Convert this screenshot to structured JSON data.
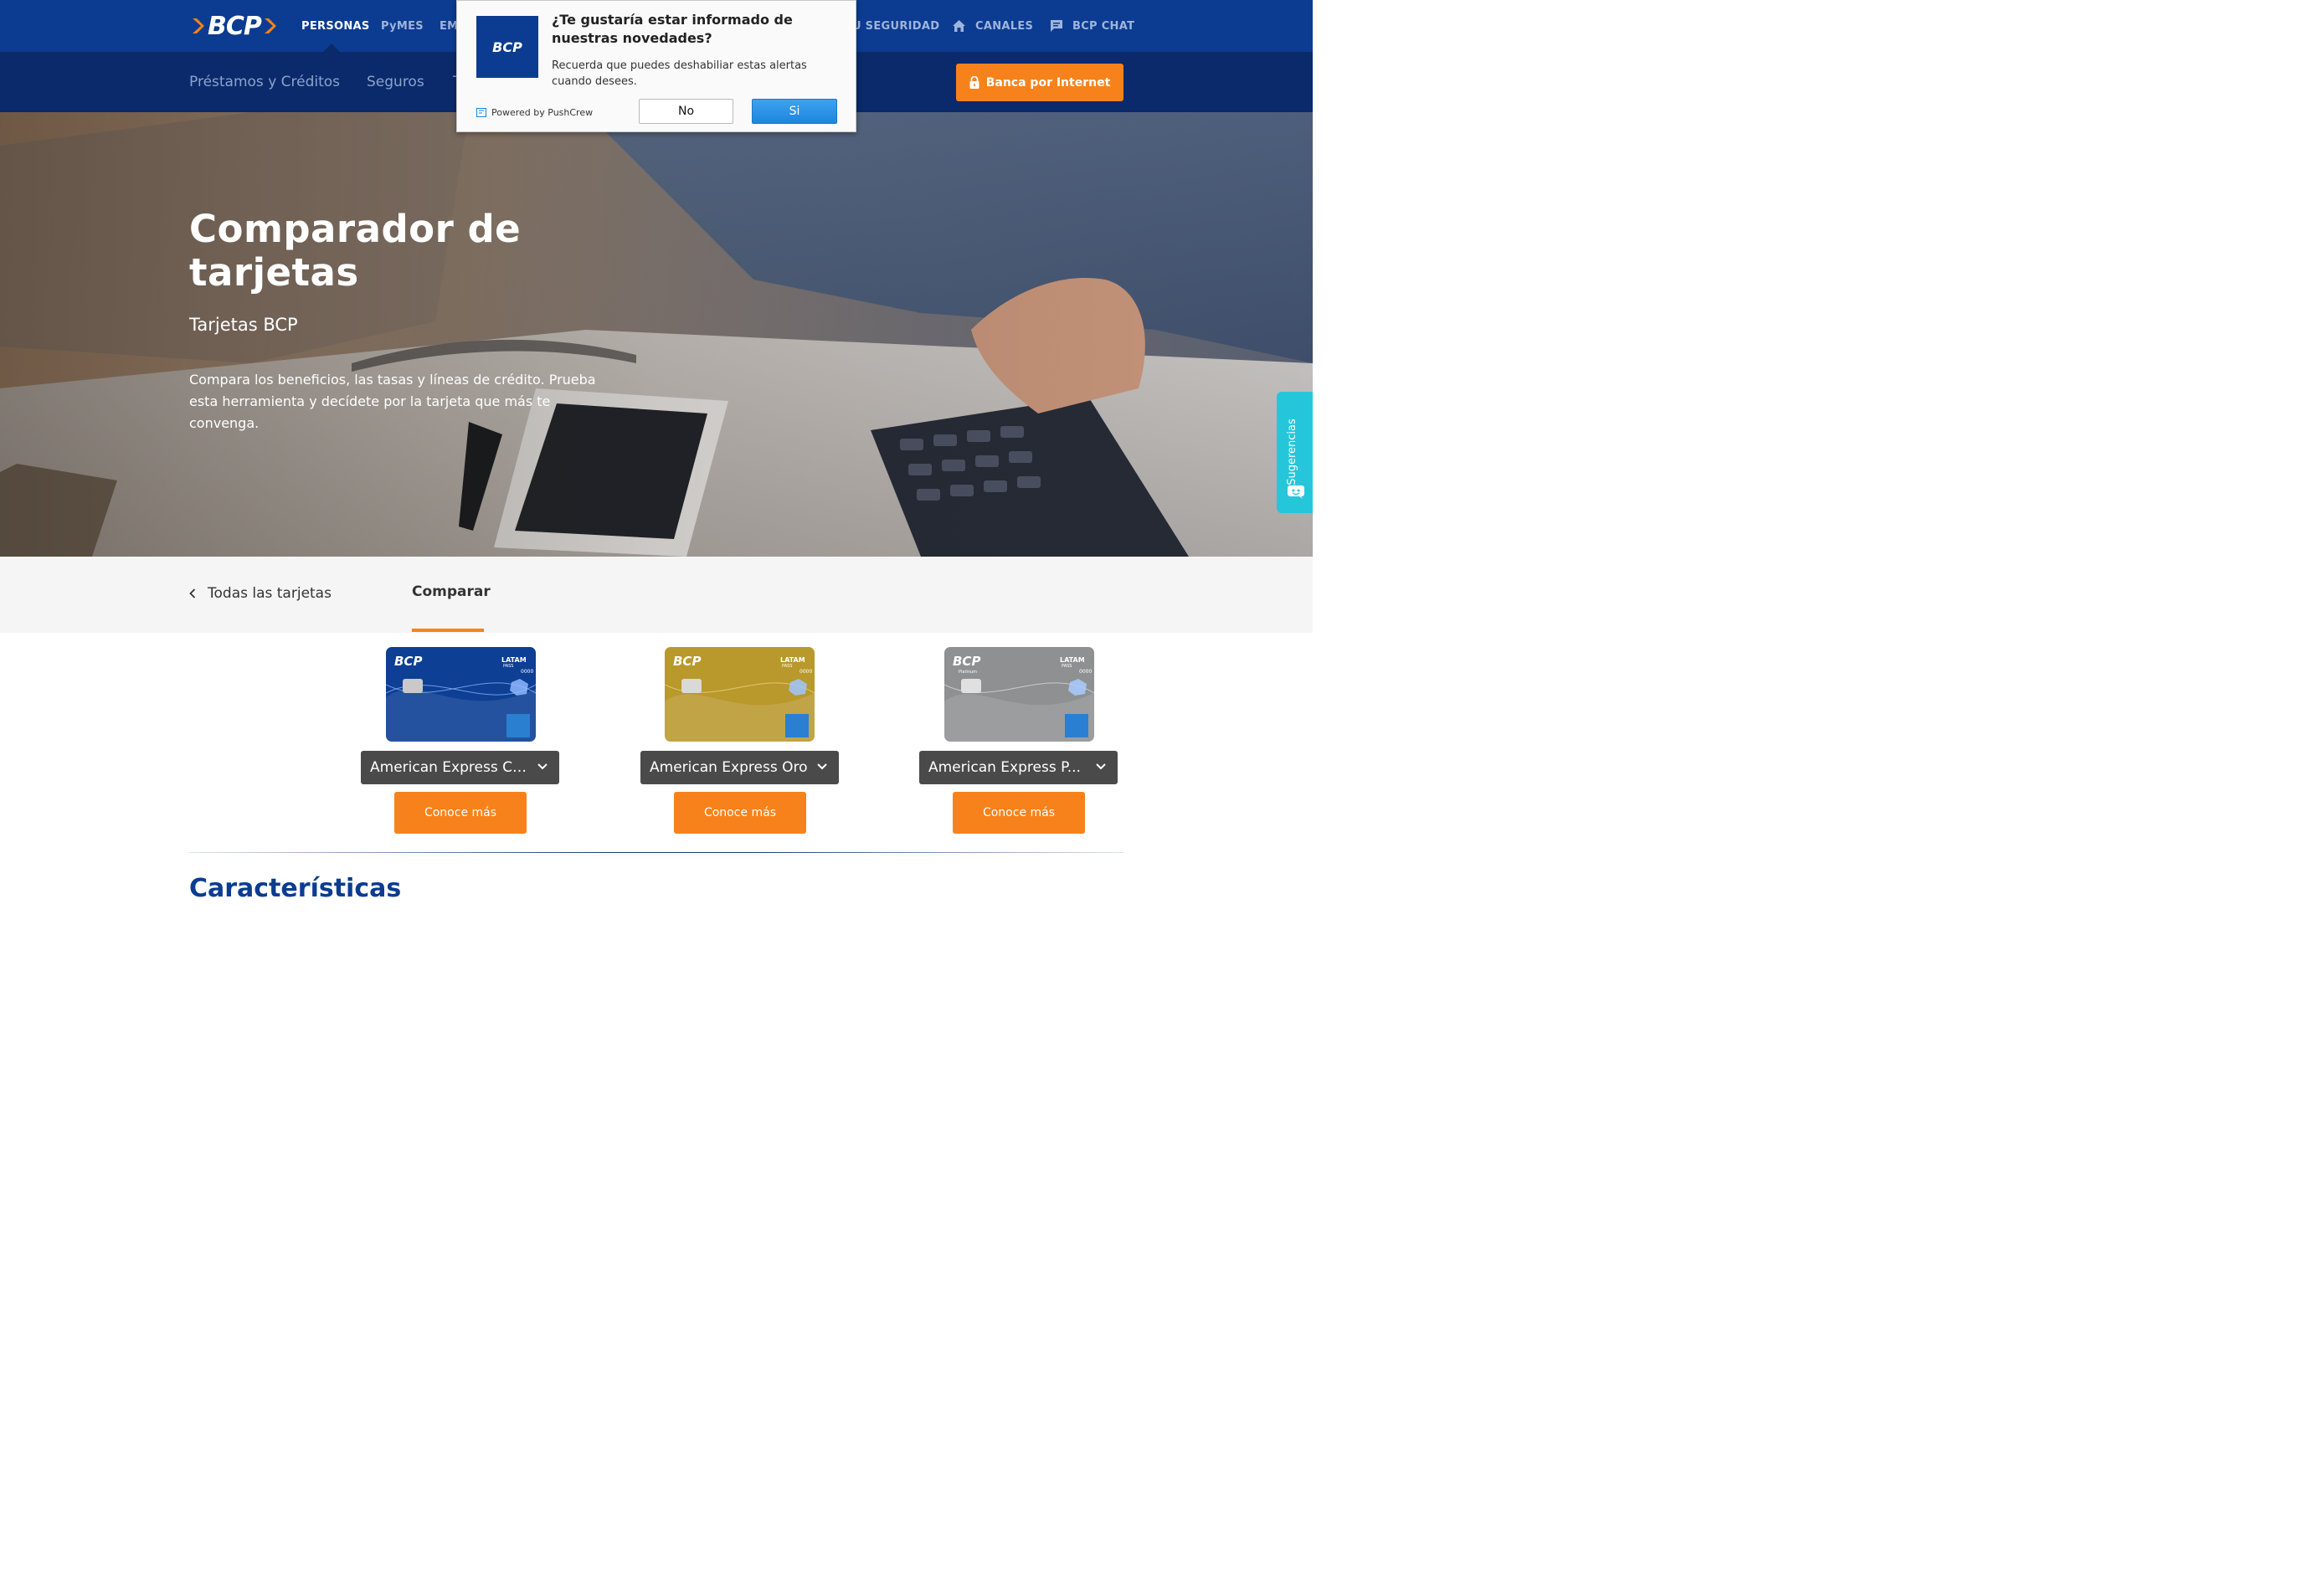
{
  "brand": {
    "logo_text": "BCP"
  },
  "topnav": {
    "items": [
      "PERSONAS",
      "PyMES",
      "EM"
    ],
    "right": {
      "seguridad": "U SEGURIDAD",
      "canales": "CANALES",
      "chat": "BCP CHAT"
    }
  },
  "subnav": {
    "items": [
      "Préstamos y Créditos",
      "Seguros",
      "T"
    ],
    "banca_button": "Banca por Internet"
  },
  "hero": {
    "title": "Comparador de tarjetas",
    "subtitle": "Tarjetas BCP",
    "description": "Compara los beneficios, las tasas y líneas de crédito. Prueba esta herramienta y decídete por la tarjeta que más te convenga."
  },
  "side_tab": {
    "label": "Sugerencias"
  },
  "tabs": {
    "back": "Todas las tarjetas",
    "compare": "Comparar"
  },
  "cards": [
    {
      "select_value": "American Express Cl...",
      "button": "Conoce más",
      "color": "#0d3f94",
      "card_logo": "BCP",
      "card_brand": "LATAM",
      "card_sub": "PASS",
      "card_num": "0000",
      "tier": ""
    },
    {
      "select_value": "American Express Oro",
      "button": "Conoce más",
      "color": "#b9982c",
      "card_logo": "BCP",
      "card_brand": "LATAM",
      "card_sub": "PASS",
      "card_num": "0000",
      "tier": ""
    },
    {
      "select_value": "American Express P...",
      "button": "Conoce más",
      "color": "#8f9092",
      "card_logo": "BCP",
      "card_brand": "LATAM",
      "card_sub": "PASS",
      "card_num": "0000",
      "tier": "Platinum"
    }
  ],
  "section": {
    "title": "Características"
  },
  "popup": {
    "logo_text": "BCP",
    "title": "¿Te gustaría estar informado de nuestras novedades?",
    "description": "Recuerda que puedes deshabiliar estas alertas cuando desees.",
    "powered": "Powered by PushCrew",
    "no": "No",
    "yes": "Si"
  },
  "colors": {
    "primary": "#0b3c91",
    "dark": "#0a2a6b",
    "accent": "#f7821b",
    "teal": "#26c6da"
  }
}
